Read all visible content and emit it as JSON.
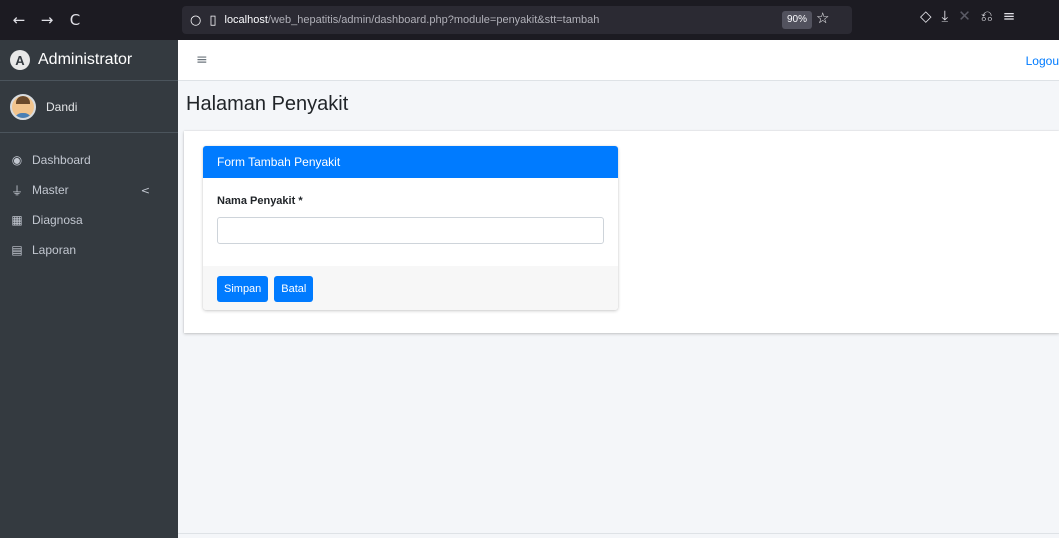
{
  "browser": {
    "back_icon": "←",
    "forward_icon": "→",
    "reload_icon": "C",
    "url_host": "localhost",
    "url_path": "/web_hepatitis/admin/dashboard.php?module=penyakit&stt=tambah",
    "zoom": "90%"
  },
  "sidebar": {
    "brand": "Administrator",
    "brand_logo": "A",
    "user_name": "Dandi",
    "items": [
      {
        "label": "Dashboard",
        "icon": "dashboard-icon",
        "glyph": "◉"
      },
      {
        "label": "Master",
        "icon": "plug-icon",
        "glyph": "⏚",
        "chevron": "<"
      },
      {
        "label": "Diagnosa",
        "icon": "building-icon",
        "glyph": "▦"
      },
      {
        "label": "Laporan",
        "icon": "book-icon",
        "glyph": "▤"
      }
    ]
  },
  "topnav": {
    "menu_icon": "≡",
    "logout": "Logou"
  },
  "page": {
    "title": "Halaman Penyakit"
  },
  "form": {
    "header": "Form Tambah Penyakit",
    "label": "Nama Penyakit *",
    "value": "",
    "submit": "Simpan",
    "cancel": "Batal"
  },
  "colors": {
    "accent": "#007bff",
    "sidebar": "#343a40"
  }
}
